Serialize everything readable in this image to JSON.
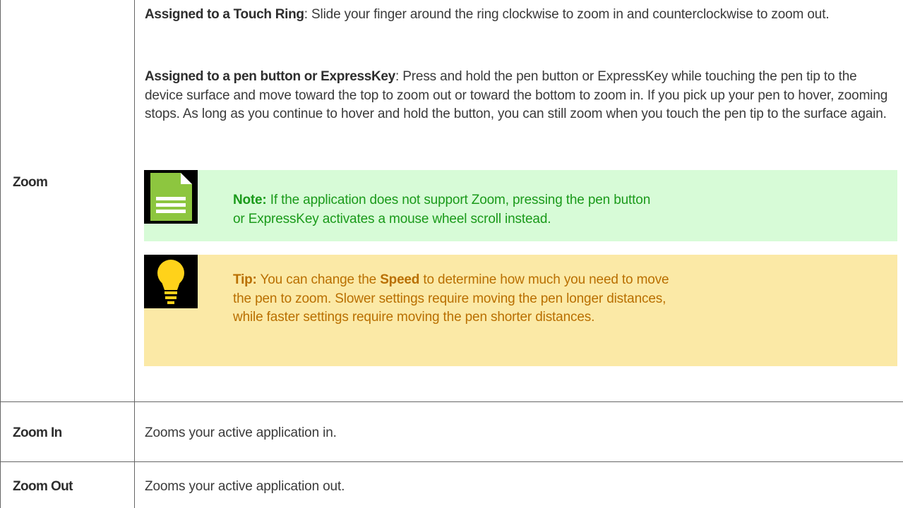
{
  "rows": [
    {
      "label": "Zoom",
      "paragraphs": [
        {
          "lead": "Assigned to a Touch Ring",
          "text": ": Slide your finger around the ring clockwise to zoom in and counterclockwise to zoom out."
        },
        {
          "lead": "Assigned to a pen button or ExpressKey",
          "text": ": Press and hold the pen button or ExpressKey while touching the pen tip to the device surface and move toward the top to zoom out or toward the bottom to zoom in. If you pick up your pen to hover, zooming stops. As long as you continue to hover and hold the button, you can still zoom when you touch the pen tip to the surface again."
        }
      ],
      "note": {
        "icon": "note-document-icon",
        "label": "Note:",
        "text": " If the application does not support Zoom, pressing the pen button or ExpressKey activates a mouse wheel scroll instead."
      },
      "tip": {
        "icon": "lightbulb-icon",
        "label": "Tip:",
        "text_before": " You can change the ",
        "emphasis": "Speed",
        "text_after": " to determine how much you need to move the pen to zoom. Slower settings require moving the pen longer distances, while faster settings require moving the pen shorter distances."
      }
    },
    {
      "label": "Zoom In",
      "description": "Zooms your active application in."
    },
    {
      "label": "Zoom Out",
      "description": "Zooms your active application out."
    }
  ],
  "colors": {
    "note_background": "#d7fbd7",
    "note_text": "#1a9a1a",
    "tip_background": "#fbe9a6",
    "tip_text": "#b96f00",
    "border": "#666666"
  }
}
